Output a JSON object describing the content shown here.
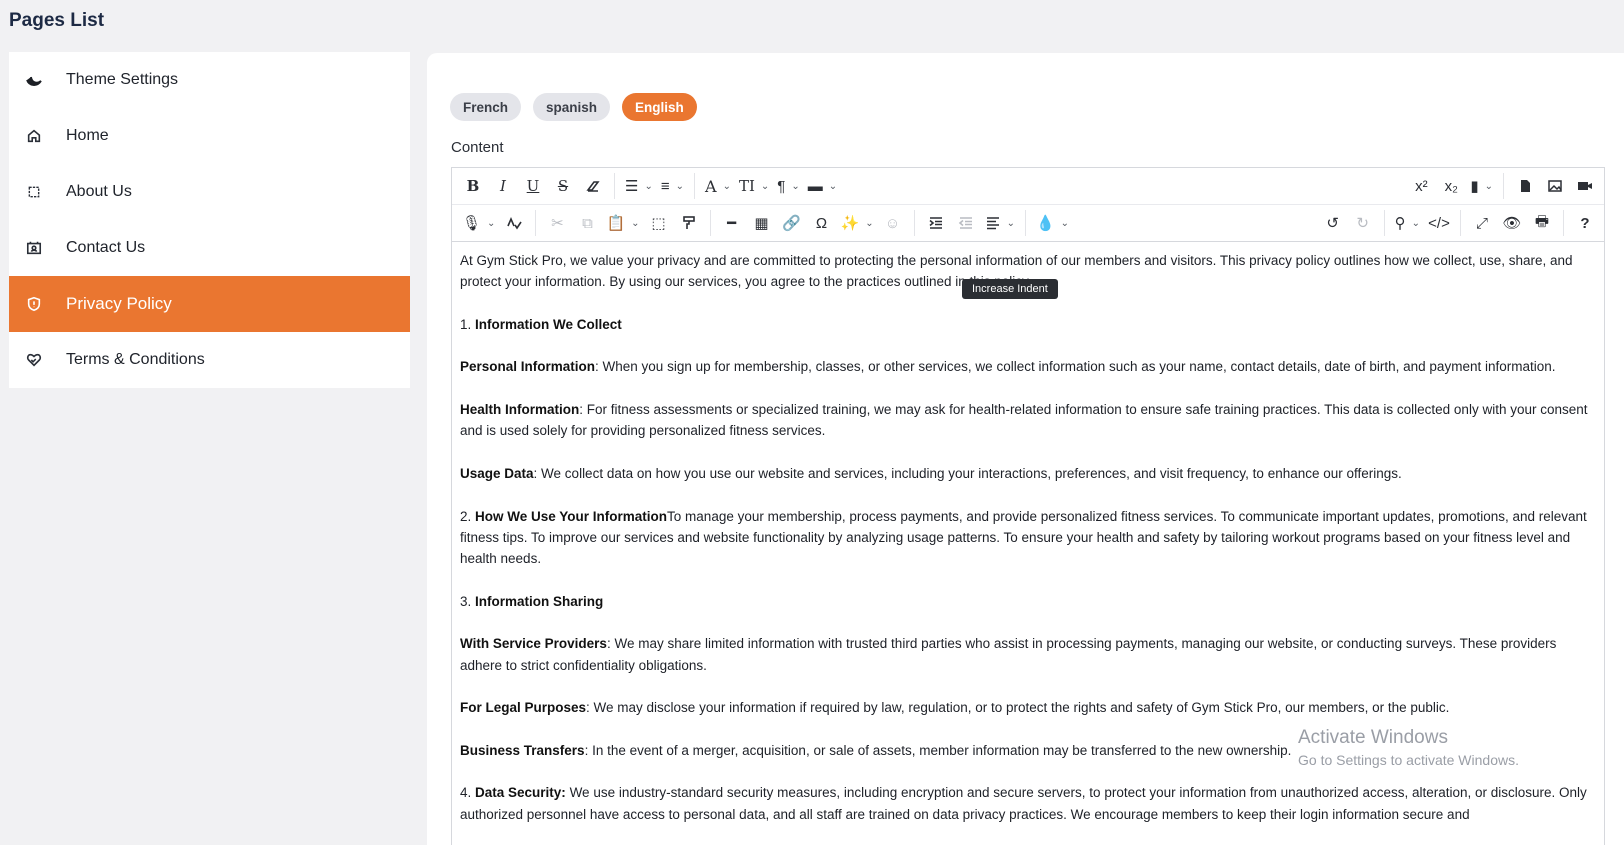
{
  "page_title": "Pages List",
  "sidebar": {
    "items": [
      {
        "label": "Theme Settings",
        "icon": "theme-swoosh-icon"
      },
      {
        "label": "Home",
        "icon": "home-icon"
      },
      {
        "label": "About Us",
        "icon": "square-dashed-icon"
      },
      {
        "label": "Contact Us",
        "icon": "contact-card-icon"
      },
      {
        "label": "Privacy Policy",
        "icon": "shield-icon",
        "active": true
      },
      {
        "label": "Terms & Conditions",
        "icon": "handshake-heart-icon"
      }
    ]
  },
  "languages": {
    "tabs": [
      "French",
      "spanish",
      "English"
    ],
    "active": "English"
  },
  "content_label": "Content",
  "toolbar": {
    "tooltip": "Increase Indent",
    "row1": [
      "bold",
      "italic",
      "underline",
      "strikethrough",
      "eraser",
      "bulleted-list",
      "numbered-list",
      "font-color",
      "font-size",
      "paragraph",
      "classes",
      "superscript",
      "subscript",
      "bookmark",
      "file",
      "image",
      "video"
    ],
    "row2": [
      "speech",
      "spellcheck",
      "cut",
      "copy",
      "paste",
      "select-all",
      "format-painter",
      "horizontal-rule",
      "table",
      "link",
      "special-char",
      "ai-magic",
      "ai-assistant",
      "indent",
      "outdent",
      "align",
      "brush",
      "undo",
      "redo",
      "find",
      "source",
      "fullsize",
      "preview",
      "print",
      "help"
    ]
  },
  "document": {
    "intro": "At Gym Stick Pro, we value your privacy and are committed to protecting the personal information of our members and visitors. This privacy policy outlines how we collect, use, share, and protect your information. By using our services, you agree to the practices outlined in this policy.",
    "s1_num": "1. ",
    "s1_title": "Information We Collect",
    "personal_label": "Personal Information",
    "personal_text": ": When you sign up for membership, classes, or other services, we collect information such as your name, contact details, date of birth, and payment information.",
    "health_label": "Health Information",
    "health_text": ": For fitness assessments or specialized training, we may ask for health-related information to ensure safe training practices. This data is collected only with your consent and is used solely for providing personalized fitness services.",
    "usage_label": "Usage Data",
    "usage_text": ": We collect data on how you use our website and services, including your interactions, preferences, and visit frequency, to enhance our offerings.",
    "s2_num": "2. ",
    "s2_title": "How We Use Your Information",
    "s2_text": "To manage your membership, process payments, and provide personalized fitness services. To communicate important updates, promotions, and relevant fitness tips. To improve our services and website functionality by analyzing usage patterns. To ensure your health and safety by tailoring workout programs based on your fitness level and health needs.",
    "s3_num": "3. ",
    "s3_title": "Information Sharing",
    "providers_label": "With Service Providers",
    "providers_text": ": We may share limited information with trusted third parties who assist in processing payments, managing our website, or conducting surveys. These providers adhere to strict confidentiality obligations.",
    "legal_label": "For Legal Purposes",
    "legal_text": ": We may disclose your information if required by law, regulation, or to protect the rights and safety of Gym Stick Pro, our members, or the public.",
    "transfers_label": "Business Transfers",
    "transfers_text": ": In the event of a merger, acquisition, or sale of assets, member information may be transferred to the new ownership.",
    "s4_num": "4. ",
    "s4_title": "Data Security:",
    "s4_text": " We use industry-standard security measures, including encryption and secure servers, to protect your information from unauthorized access, alteration, or disclosure. Only authorized personnel have access to personal data, and all staff are trained on data privacy practices. We encourage members to keep their login information secure and"
  },
  "watermark": {
    "line1": "Activate Windows",
    "line2": "Go to Settings to activate Windows."
  },
  "colors": {
    "accent": "#ea7630",
    "background": "#f1f1f3"
  }
}
